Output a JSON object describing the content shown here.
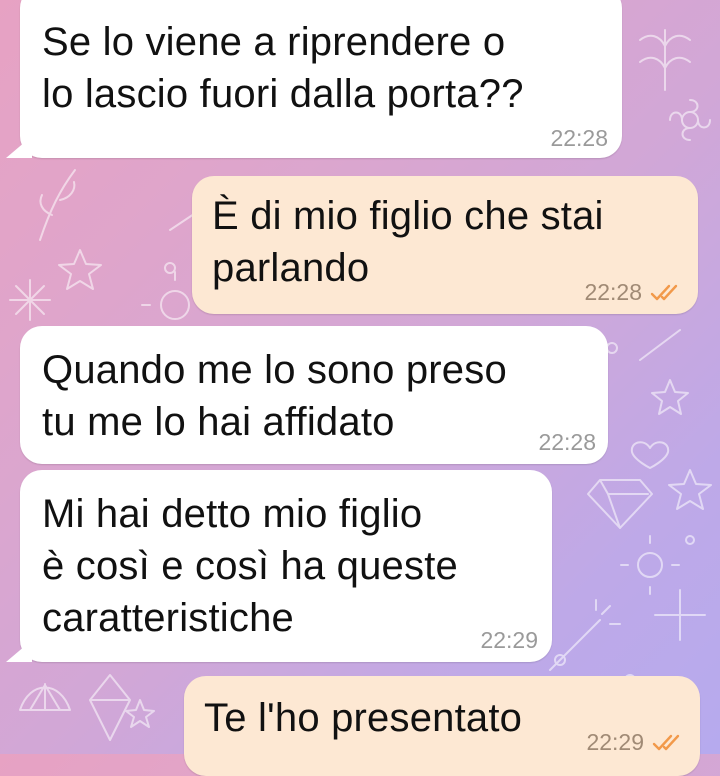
{
  "chat": {
    "messages": [
      {
        "direction": "incoming",
        "text": "Se lo viene a riprendere o\nlo lascio fuori dalla porta??",
        "time": "22:28"
      },
      {
        "direction": "outgoing",
        "text": "È di mio figlio che stai\nparlando",
        "time": "22:28",
        "status": "read"
      },
      {
        "direction": "incoming",
        "text": "Quando me lo sono preso\ntu me lo hai affidato",
        "time": "22:28"
      },
      {
        "direction": "incoming",
        "text": "Mi hai detto mio figlio\nè così e così ha queste\ncaratteristiche",
        "time": "22:29"
      },
      {
        "direction": "outgoing",
        "text": "Te l'ho presentato",
        "time": "22:29",
        "status": "read"
      }
    ]
  },
  "colors": {
    "incoming_bubble": "#ffffff",
    "outgoing_bubble": "#fde8d3",
    "read_ticks": "#f2994a",
    "wallpaper_gradient": [
      "#e7a2c3",
      "#bea9e8"
    ]
  },
  "icons": {
    "read_receipt": "double-check-icon"
  }
}
